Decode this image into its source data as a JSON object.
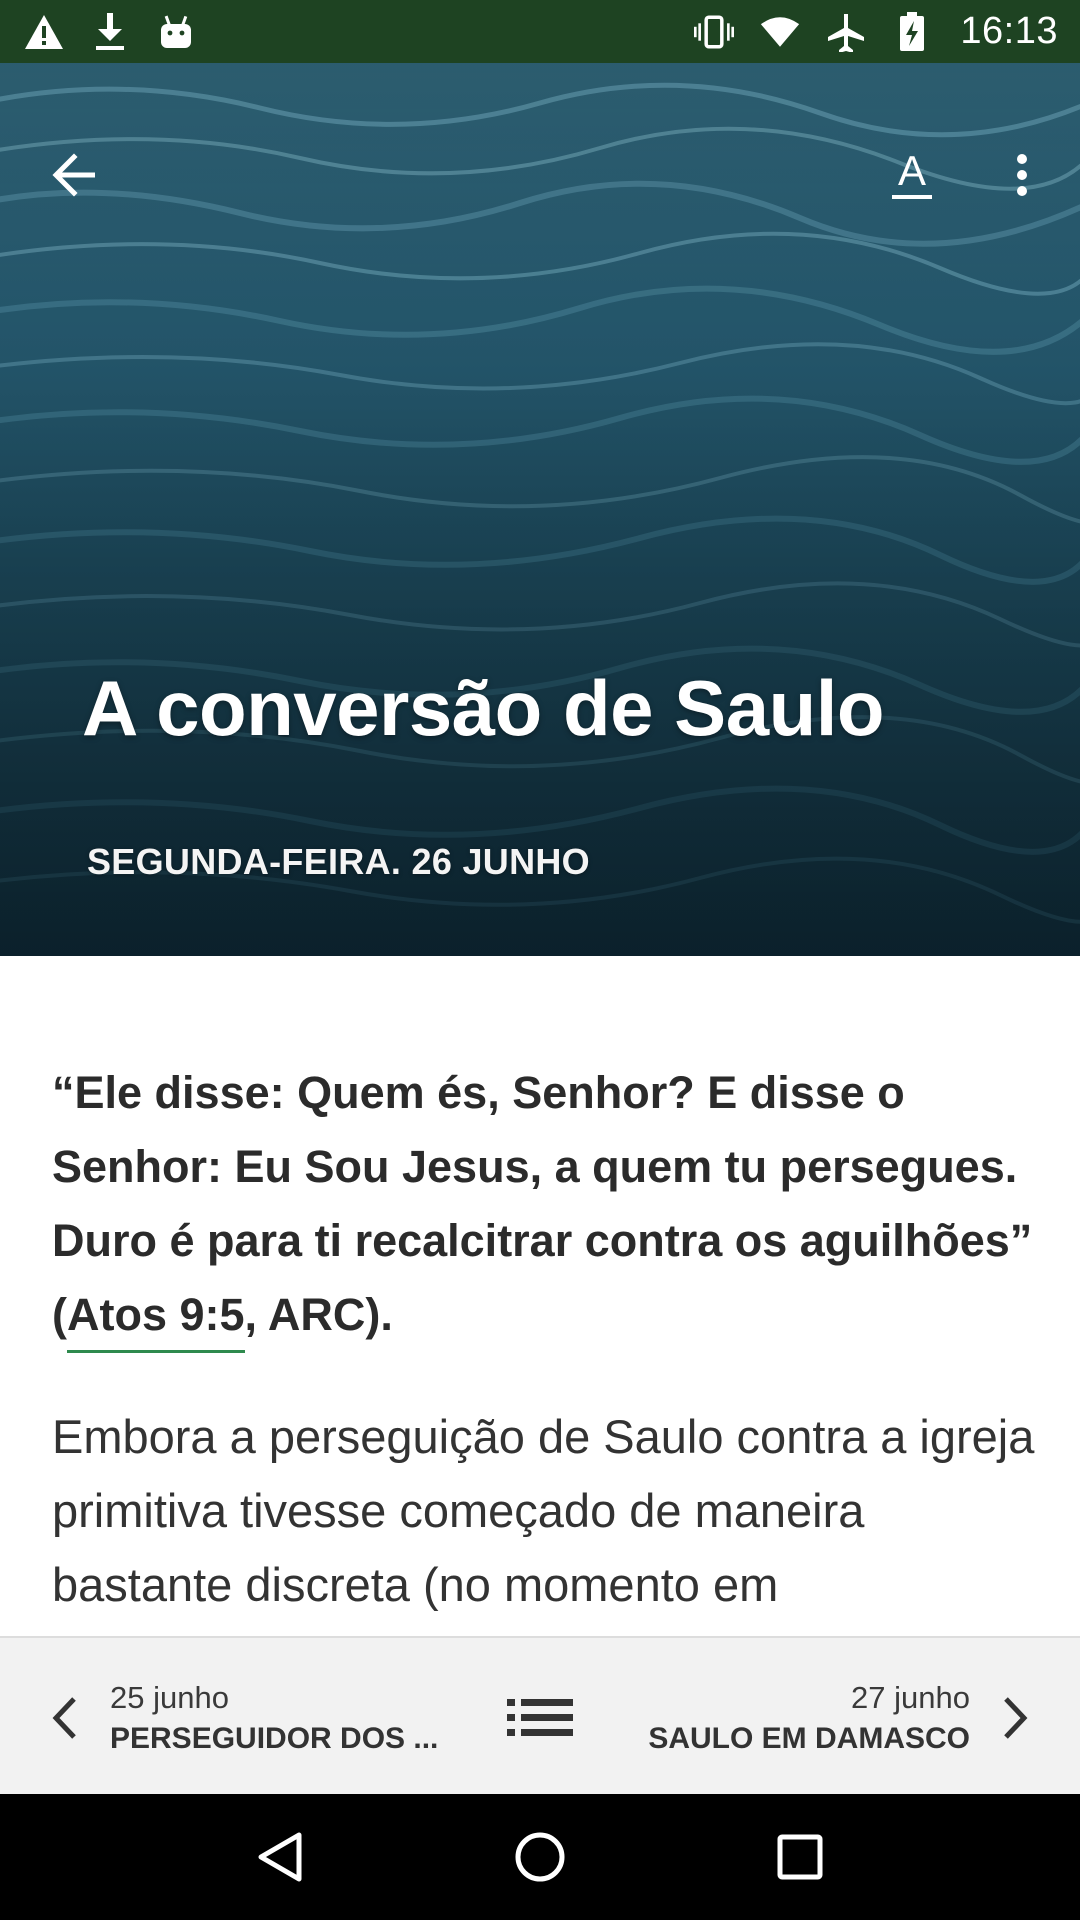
{
  "status_bar": {
    "time": "16:13",
    "left_icons": [
      "warning-icon",
      "download-icon",
      "android-icon"
    ],
    "right_icons": [
      "vibrate-icon",
      "wifi-icon",
      "airplane-icon",
      "battery-icon"
    ]
  },
  "hero": {
    "title": "A conversão de Saulo",
    "date": "SEGUNDA-FEIRA. 26 JUNHO",
    "toolbar": {
      "back_icon": "arrow-left-icon",
      "font_icon": "text-format-icon",
      "font_glyph": "A",
      "more_icon": "more-vertical-icon"
    }
  },
  "article": {
    "quote_text": "“Ele disse: Quem és, Senhor? E disse o Senhor: Eu Sou Jesus, a quem tu persegues. Duro é para ti recalcitrar contra os aguilhões” (",
    "quote_ref": "Atos 9:5",
    "quote_tail": ", ARC).",
    "paragraph": "Embora a perseguição de Saulo contra a igreja primitiva tivesse começado de maneira bastante discreta (no momento em"
  },
  "day_nav": {
    "prev": {
      "date": "25 junho",
      "title": "PERSEGUIDOR DOS ..."
    },
    "next": {
      "date": "27 junho",
      "title": "SAULO EM DAMASCO"
    }
  },
  "colors": {
    "status_bar": "#1e4322",
    "link_underline": "#2e8a4e",
    "nav_background": "#f2f2f2"
  }
}
